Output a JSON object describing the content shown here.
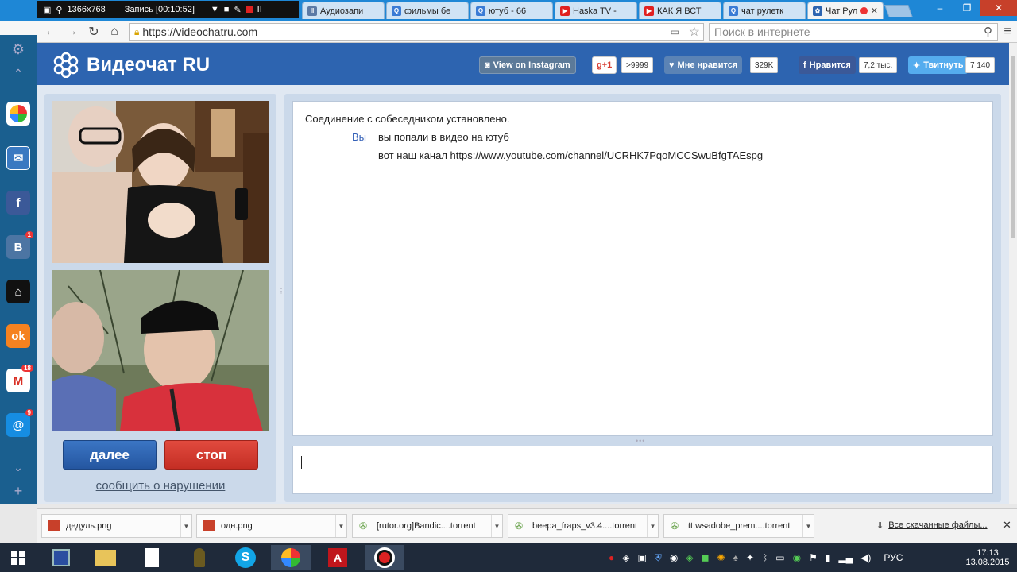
{
  "recorder": {
    "resolution": "1366x768",
    "status": "Запись [00:10:52]"
  },
  "tabs": [
    {
      "label": "Аудиозапи",
      "color": "#5b7aa6",
      "glyph": "II"
    },
    {
      "label": "фильмы бе",
      "color": "#3a7bd5",
      "glyph": "Q"
    },
    {
      "label": "ютуб - 66",
      "color": "#3a7bd5",
      "glyph": "Q"
    },
    {
      "label": "Haska TV -",
      "color": "#e02020",
      "glyph": "▶"
    },
    {
      "label": "КАК Я ВСТ",
      "color": "#e02020",
      "glyph": "▶"
    },
    {
      "label": "чат рулетк",
      "color": "#3a7bd5",
      "glyph": "Q"
    },
    {
      "label": "Чат Рул",
      "color": "#2d64b0",
      "glyph": "✿"
    }
  ],
  "browser": {
    "url": "https://videochatru.com",
    "search_placeholder": "Поиск в интернете"
  },
  "sidebar": {
    "badges": {
      "vk": "1",
      "gmail": "18",
      "mail": "9"
    }
  },
  "site": {
    "logo": "Видеочат RU",
    "instagram": "View on Instagram",
    "gplus": "g+1",
    "gplus_count": ">9999",
    "like": "Мне нравится",
    "like_count": "329K",
    "fb": "Нравится",
    "fb_count": "7,2 тыс.",
    "tw": "Твитнуть",
    "tw_count": "7 140"
  },
  "chat": {
    "system": "Соединение с собеседником установлено.",
    "you_label": "Вы",
    "messages": [
      "вы попали в видео на ютуб",
      "вот наш канал https://www.youtube.com/channel/UCRHK7PqoMCCSwuBfgTAEspg"
    ]
  },
  "controls": {
    "next": "далее",
    "stop": "стоп",
    "report": "сообщить о нарушении"
  },
  "downloads": {
    "items": [
      "дедуль.png",
      "одн.png",
      "[rutor.org]Bandic....torrent",
      "beepa_fraps_v3.4....torrent",
      "tt.wsadobe_prem....torrent"
    ],
    "all": "Все скачанные файлы..."
  },
  "taskbar": {
    "lang": "РУС",
    "time": "17:13",
    "date": "13.08.2015"
  }
}
